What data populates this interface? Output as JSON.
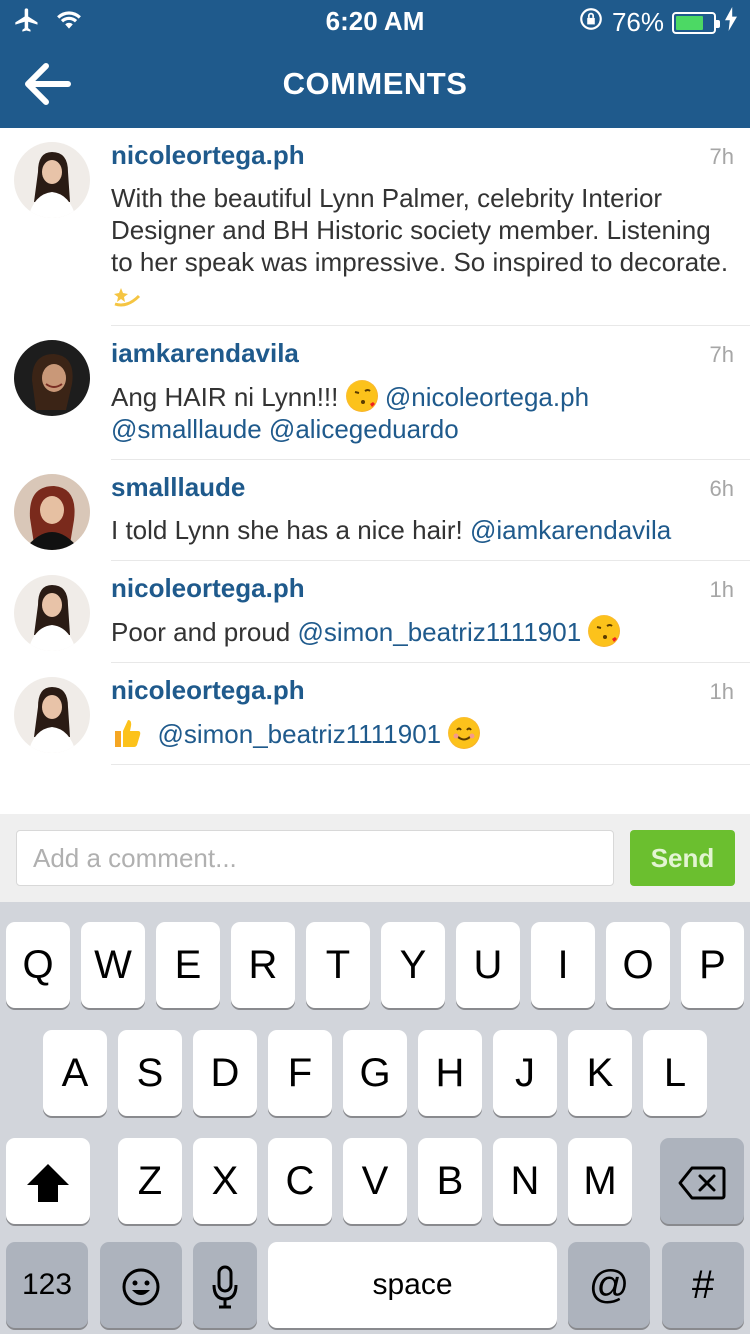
{
  "status_bar": {
    "time": "6:20 AM",
    "battery_percent": "76%",
    "battery_level": 0.76
  },
  "header": {
    "title": "COMMENTS"
  },
  "comments": [
    {
      "username": "nicoleortega.ph",
      "time": "7h",
      "text": "With the beautiful Lynn Palmer, celebrity Interior Designer and BH Historic society member. Listening to her speak was impressive. So inspired to decorate.",
      "emoji": "sparkle"
    },
    {
      "username": "iamkarendavila",
      "time": "7h",
      "text_before": "Ang HAIR ni Lynn!!!",
      "mention1": "@nicoleortega.ph",
      "mention2": "@smalllaude",
      "mention3": "@alicegeduardo"
    },
    {
      "username": "smalllaude",
      "time": "6h",
      "text_before": "I told Lynn she has a nice hair!",
      "mention1": "@iamkarendavila"
    },
    {
      "username": "nicoleortega.ph",
      "time": "1h",
      "text_before": "Poor and proud",
      "mention1": "@simon_beatriz1111901"
    },
    {
      "username": "nicoleortega.ph",
      "time": "1h",
      "mention1": "@simon_beatriz1111901"
    }
  ],
  "compose": {
    "placeholder": "Add a comment...",
    "send_label": "Send"
  },
  "keyboard": {
    "row1": [
      "Q",
      "W",
      "E",
      "R",
      "T",
      "Y",
      "U",
      "I",
      "O",
      "P"
    ],
    "row2": [
      "A",
      "S",
      "D",
      "F",
      "G",
      "H",
      "J",
      "K",
      "L"
    ],
    "row3": [
      "Z",
      "X",
      "C",
      "V",
      "B",
      "N",
      "M"
    ],
    "numbers_label": "123",
    "space_label": "space",
    "at_label": "@",
    "hash_label": "#"
  },
  "colors": {
    "header": "#1f5a8c",
    "accent": "#1f5a8c",
    "send": "#6bbf2f"
  }
}
